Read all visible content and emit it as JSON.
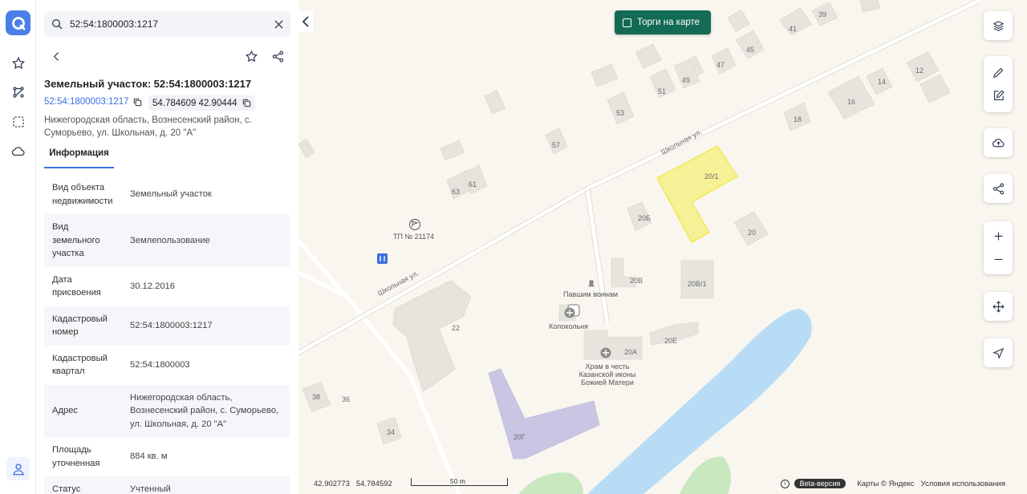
{
  "search": {
    "value": "52:54:1800003:1217",
    "placeholder": ""
  },
  "rail": {
    "items": [
      "logo-icon",
      "star-icon",
      "route-icon",
      "selection-icon",
      "cloud-icon",
      "user-icon"
    ]
  },
  "panel": {
    "title": "Земельный участок: 52:54:1800003:1217",
    "cadastral_link": "52:54:1800003:1217",
    "coordinates": "54.784609 42.90444",
    "address": "Нижегородская область, Вознесенский район, с. Суморьево, ул. Школьная, д. 20 \"А\"",
    "tab": "Информация",
    "rows": [
      {
        "key": "Вид объекта недвижимости",
        "value": "Земельный участок"
      },
      {
        "key": "Вид земельного участка",
        "value": "Землепользование"
      },
      {
        "key": "Дата присвоения",
        "value": "30.12.2016"
      },
      {
        "key": "Кадастровый номер",
        "value": "52:54:1800003:1217"
      },
      {
        "key": "Кадастровый квартал",
        "value": "52:54:1800003"
      },
      {
        "key": "Адрес",
        "value": "Нижегородская область, Вознесенский район, с. Суморьево, ул. Школьная, д. 20 \"А\""
      },
      {
        "key": "Площадь уточненная",
        "value": "884 кв. м"
      },
      {
        "key": "Статус",
        "value": "Учтенный"
      }
    ]
  },
  "map": {
    "toggle_label": "Торги на карте",
    "street_labels": [
      "Школьная ул.",
      "Школьная ул."
    ],
    "house_numbers": [
      "39",
      "41",
      "45",
      "47",
      "49",
      "51",
      "53",
      "57",
      "61",
      "63",
      "12",
      "14",
      "16",
      "18",
      "20/1",
      "20Б",
      "20",
      "20В",
      "20В/1",
      "20Е",
      "20А",
      "22",
      "20Г",
      "38",
      "36",
      "34"
    ],
    "poi": {
      "substation": "ТП № 21174",
      "memorial": "Павшим воинам",
      "belfry": "Колокольня",
      "church": "Храм в честь Казанской иконы Божией Матери"
    },
    "status": {
      "lon": "42.902773",
      "lat": "54.784592",
      "scale": "50 m",
      "beta": "Beta-версия",
      "attribution": "Карты © Яндекс",
      "terms": "Условия использования"
    },
    "colors": {
      "parcel": "#f5ef5a",
      "water": "#b8dcf5",
      "building": "#e6e4dd",
      "building_violet": "#c9c6e3",
      "accent": "#3a6fe0",
      "toggle": "#146b55"
    }
  }
}
